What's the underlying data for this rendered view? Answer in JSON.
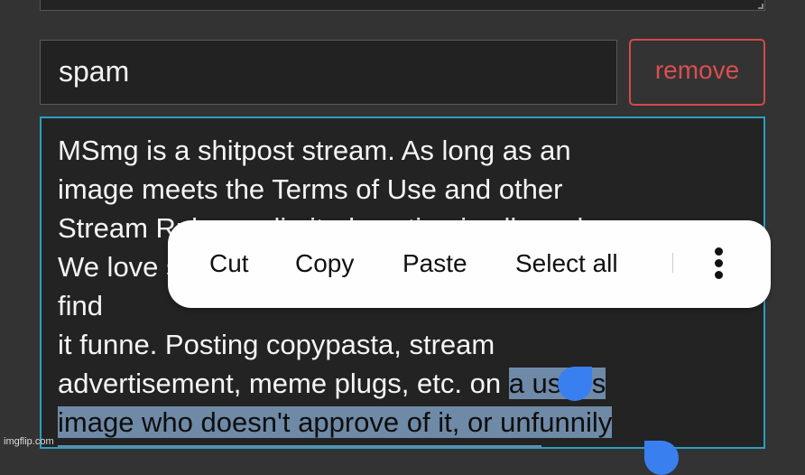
{
  "tag_field": {
    "value": "spam"
  },
  "remove_button": {
    "label": "remove"
  },
  "description": {
    "text_before_selection": "MSmg is a shitpost stream. As long as an\nimage meets the Terms of Use and other\nStream Rules, unlimited posting is allowed.\nWe love shitposting, but not when someone doesn't find\nit funne. Posting copypasta, stream\nadvertisement, meme plugs, etc. on ",
    "selected_text": "a user's\nimage who doesn't approve of it, or unfunnily\nspamming it makes you an uncool user",
    "text_after_selection": "."
  },
  "context_menu": {
    "items": [
      {
        "label": "Cut"
      },
      {
        "label": "Copy"
      },
      {
        "label": "Paste"
      },
      {
        "label": "Select all"
      }
    ],
    "more_icon": "more-vertical-icon"
  },
  "colors": {
    "accent": "#2b9fc0",
    "danger": "#d94f4f",
    "selection": "#6f8aa7",
    "handle": "#3a7ff0"
  },
  "watermark": "imgflip.com"
}
